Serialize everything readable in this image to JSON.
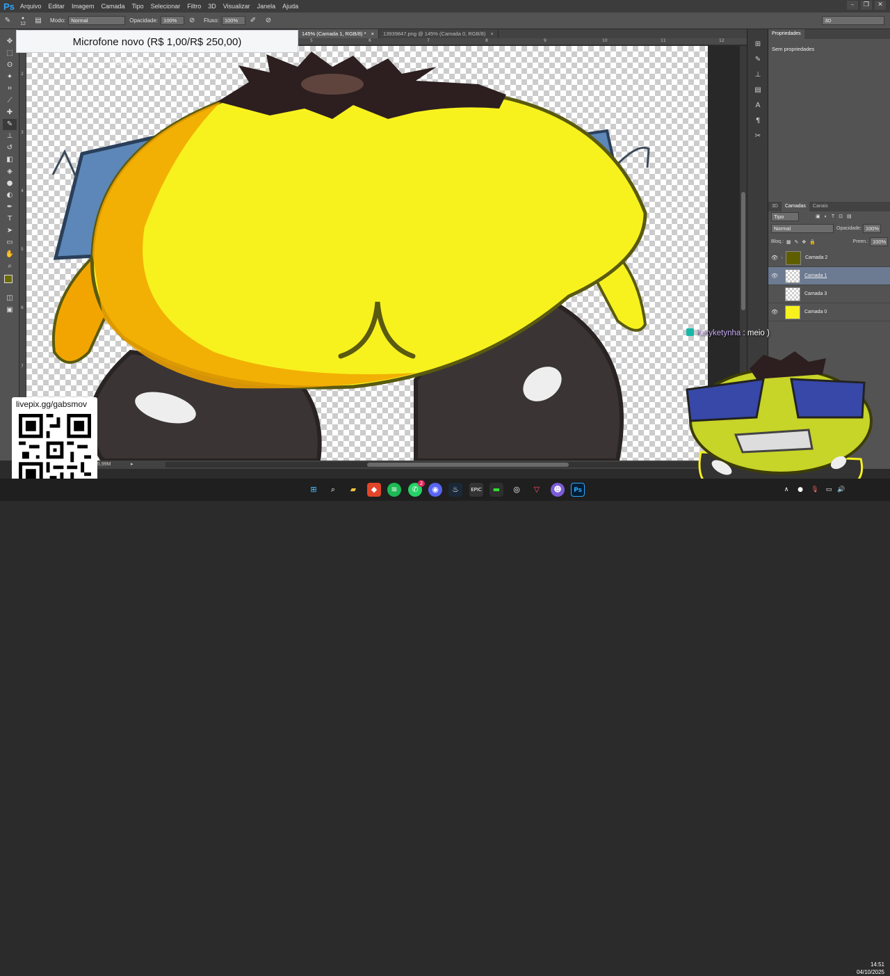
{
  "app": {
    "name": "Ps"
  },
  "menu": [
    "Arquivo",
    "Editar",
    "Imagem",
    "Camada",
    "Tipo",
    "Selecionar",
    "Filtro",
    "3D",
    "Visualizar",
    "Janela",
    "Ajuda"
  ],
  "options": {
    "brush_size": "12",
    "mode_label": "Modo:",
    "mode_value": "Normal",
    "opacity_label": "Opacidade:",
    "opacity_value": "100%",
    "flow_label": "Fluxo:",
    "flow_value": "100%",
    "workspace": "3D"
  },
  "tabs": [
    {
      "label": "145% (Camada 1, RGB/8) *",
      "close": "×",
      "active": true
    },
    {
      "label": "13939847.png @ 145% (Camada 0, RGB/8)",
      "close": "×",
      "active": false
    }
  ],
  "ruler_top": [
    "5",
    "6",
    "7",
    "8",
    "9",
    "10",
    "11",
    "12"
  ],
  "ruler_left": [
    "2",
    "3",
    "4",
    "5",
    "6",
    "7"
  ],
  "status": {
    "doc_size": "5,99M"
  },
  "properties": {
    "tab": "Propriedades",
    "content": "Sem propriedades"
  },
  "layers_panel": {
    "tabs": [
      "3D",
      "Camadas",
      "Canais"
    ],
    "filter": "Tipo",
    "blend_mode": "Normal",
    "opacity_label": "Opacidade:",
    "opacity_value": "100%",
    "lock_label": "Bloq.:",
    "fill_label": "Preen.:",
    "fill_value": "100%",
    "layers": [
      {
        "name": "Camada 2",
        "visible": true,
        "selected": false
      },
      {
        "name": "Camada 1",
        "visible": true,
        "selected": true
      },
      {
        "name": "Camada 3",
        "visible": false,
        "selected": false
      },
      {
        "name": "Camada 0",
        "visible": true,
        "selected": false
      }
    ]
  },
  "stream_overlay": {
    "goal_title": "Microfone novo (R$ 1,00/R$ 250,00)",
    "goal_subtitle": "Termina em 2 meses",
    "donation_url": "livepix.gg/gabsmov",
    "chat_user": "Ketyketynha",
    "chat_message": ": meio )"
  },
  "taskbar": {
    "time": "14:51",
    "date": "04/10/2025",
    "whatsapp_badge": "2"
  },
  "colors": {
    "accent": "#2fa3f6",
    "foreground_swatch": "#6b6b00",
    "background_swatch": "#f4ee1c",
    "character_yellow": "#f7f21e"
  }
}
